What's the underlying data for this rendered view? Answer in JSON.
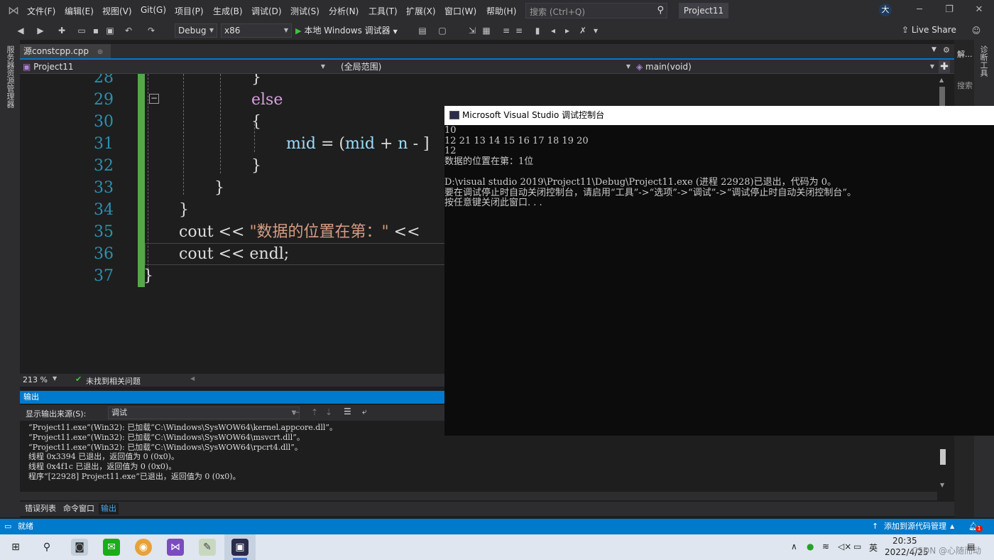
{
  "menu": {
    "items": [
      "文件(F)",
      "编辑(E)",
      "视图(V)",
      "Git(G)",
      "项目(P)",
      "生成(B)",
      "调试(D)",
      "测试(S)",
      "分析(N)",
      "工具(T)",
      "扩展(X)",
      "窗口(W)",
      "帮助(H)"
    ],
    "search_placeholder": "搜索 (Ctrl+Q)",
    "solution_name": "Project11",
    "user_initial": "大"
  },
  "toolbar": {
    "config": "Debug",
    "platform": "x86",
    "run_label": "本地 Windows 调试器",
    "live_share": "Live Share"
  },
  "left_strip_label": "服务器资源管理器",
  "right_panel": {
    "top_label": "解...",
    "side_label": "诊断工具",
    "search_label": "搜索"
  },
  "editor": {
    "tab_label": "源constcpp.cpp",
    "project_dropdown": "Project11",
    "scope_dropdown": "(全局范围)",
    "member_dropdown": "main(void)",
    "line_numbers": [
      "28",
      "29",
      "30",
      "31",
      "32",
      "33",
      "34",
      "35",
      "36",
      "37"
    ],
    "code": {
      "l28": "}",
      "l29": "else",
      "l30": "{",
      "l31_var": "mid",
      "l31_rest": " = (",
      "l31_var2": "mid",
      "l31_op": " + ",
      "l31_var3": "n",
      "l31_tail": " - ]",
      "l32": "}",
      "l33": "}",
      "l34": "}",
      "l35_a": "cout << ",
      "l35_str": "\"数据的位置在第：\"",
      "l35_b": " <<",
      "l36": "cout << endl;",
      "l37": "}"
    },
    "zoom": "213 %",
    "issues": "未找到相关问题"
  },
  "console": {
    "title": "Microsoft Visual Studio 调试控制台",
    "lines": [
      "10",
      "12 21 13 14 15 16 17 18 19 20",
      "12",
      "数据的位置在第：1位",
      "",
      "D:\\visual studio 2019\\Project11\\Debug\\Project11.exe (进程 22928)已退出，代码为 0。",
      "要在调试停止时自动关闭控制台，请启用“工具”->“选项”->“调试”->“调试停止时自动关闭控制台”。",
      "按任意键关闭此窗口. . ."
    ]
  },
  "output": {
    "header": "输出",
    "source_label": "显示输出来源(S):",
    "source_value": "调试",
    "lines": [
      "“Project11.exe”(Win32): 已加载“C:\\Windows\\SysWOW64\\kernel.appcore.dll”。",
      "“Project11.exe”(Win32): 已加载“C:\\Windows\\SysWOW64\\msvcrt.dll”。",
      "“Project11.exe”(Win32): 已加载“C:\\Windows\\SysWOW64\\rpcrt4.dll”。",
      "线程 0x3394 已退出，返回值为 0 (0x0)。",
      "线程 0x4f1c 已退出，返回值为 0 (0x0)。",
      "程序“[22928] Project11.exe”已退出，返回值为 0 (0x0)。"
    ],
    "bottom_tabs": [
      "错误列表",
      "命令窗口",
      "输出"
    ]
  },
  "statusbar": {
    "ready": "就绪",
    "source_control": "添加到源代码管理",
    "notifications": "1"
  },
  "taskbar": {
    "ime": "英",
    "time": "20:35",
    "date": "2022/4/25",
    "watermark": "CSDN @心随而动"
  },
  "colors": {
    "accent": "#007acc",
    "editor_bg": "#1e1e1e",
    "chrome_bg": "#2d2d30",
    "console_bg": "#0c0c0c"
  }
}
